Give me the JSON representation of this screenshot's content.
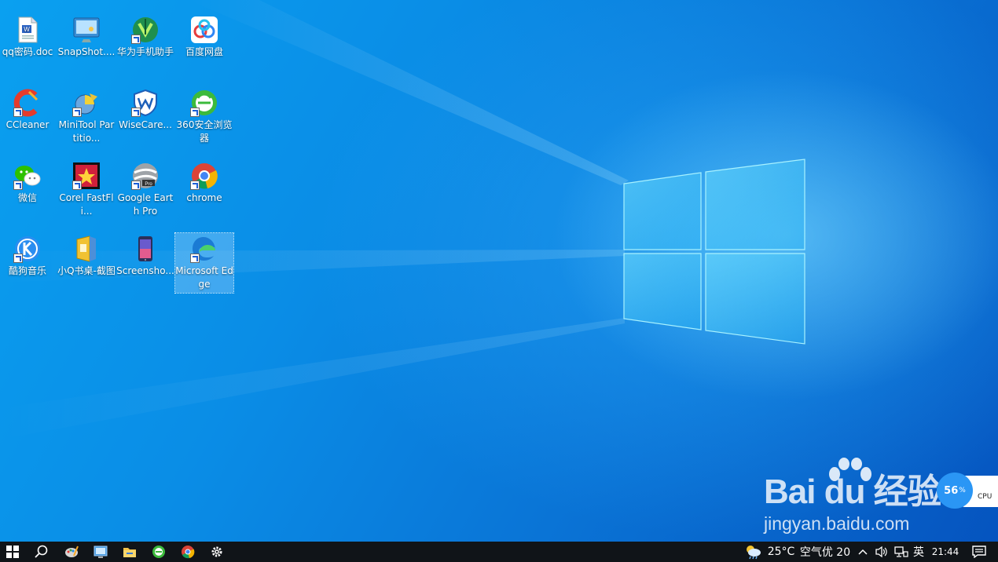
{
  "desktop": {
    "icons": [
      {
        "label": "qq密码.doc",
        "icon": "word-doc-icon"
      },
      {
        "label": "SnapShot....",
        "icon": "snapshot-icon"
      },
      {
        "label": "华为手机助手",
        "icon": "huawei-hisuite-icon"
      },
      {
        "label": "百度网盘",
        "icon": "baidu-netdisk-icon"
      },
      {
        "label": "CCleaner",
        "icon": "ccleaner-icon"
      },
      {
        "label": "MiniTool Partitio...",
        "icon": "minitool-icon"
      },
      {
        "label": "WiseCare...",
        "icon": "wisecare-icon"
      },
      {
        "label": "360安全浏览器",
        "icon": "360-browser-icon"
      },
      {
        "label": "微信",
        "icon": "wechat-icon"
      },
      {
        "label": "Corel FastFli...",
        "icon": "corel-fastflick-icon"
      },
      {
        "label": "Google Earth Pro",
        "icon": "google-earth-icon"
      },
      {
        "label": "chrome",
        "icon": "chrome-icon"
      },
      {
        "label": "酷狗音乐",
        "icon": "kugou-icon"
      },
      {
        "label": "小Q书桌-截图",
        "icon": "xiaoq-desk-icon"
      },
      {
        "label": "Screensho...",
        "icon": "screenshot-app-icon"
      },
      {
        "label": "Microsoft Edge",
        "icon": "edge-icon"
      }
    ]
  },
  "watermark": {
    "brand": "Bai du 经验",
    "url": "jingyan.baidu.com"
  },
  "cpu_widget": {
    "percent": "56",
    "percent_sign": "%",
    "label": "CPU"
  },
  "taskbar": {
    "weather": "25°C",
    "air_quality": "空气优 20",
    "ime": "英",
    "time": "21:44"
  }
}
